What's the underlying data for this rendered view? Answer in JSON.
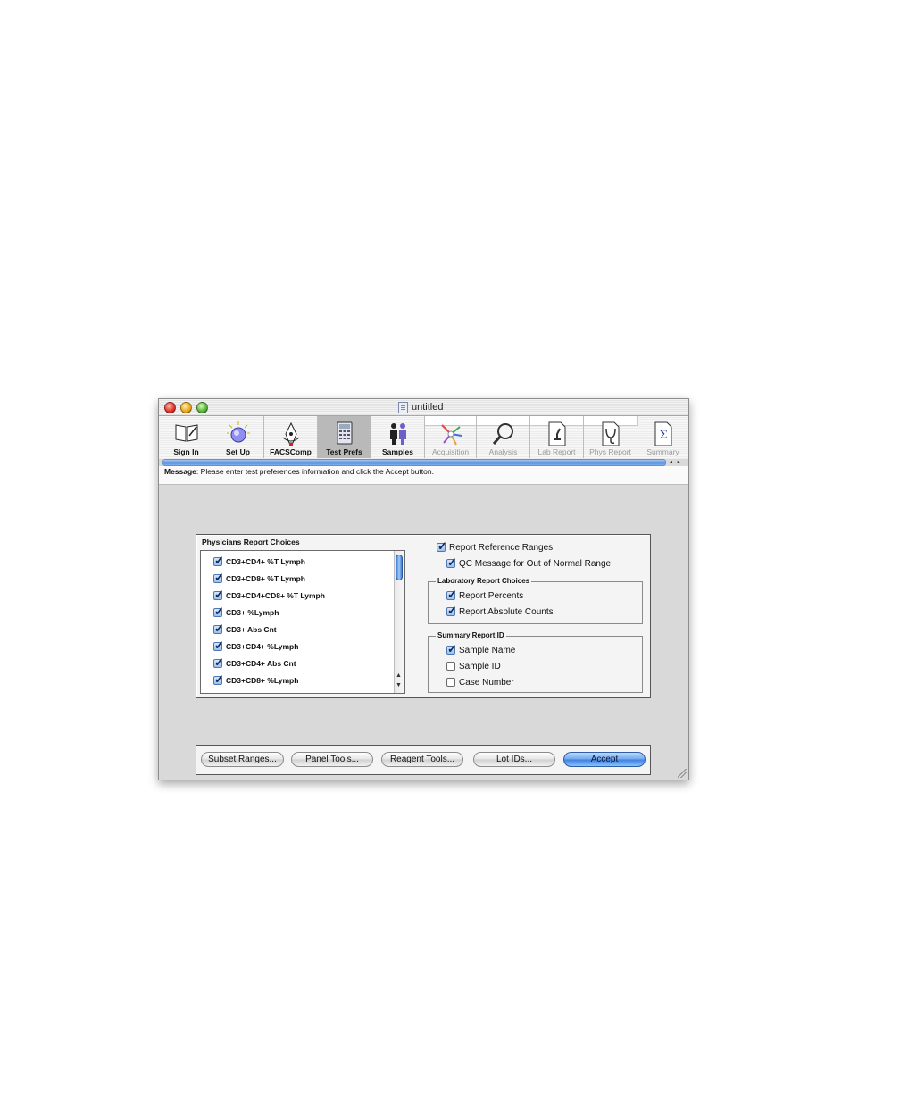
{
  "window": {
    "title": "untitled"
  },
  "toolbar": {
    "items": [
      {
        "label": "Sign In",
        "icon": "book-icon",
        "active": false,
        "enabled": true
      },
      {
        "label": "Set Up",
        "icon": "bead-icon",
        "active": false,
        "enabled": true
      },
      {
        "label": "FACSComp",
        "icon": "pen-icon",
        "active": false,
        "enabled": true
      },
      {
        "label": "Test Prefs",
        "icon": "calculator-icon",
        "active": true,
        "enabled": true
      },
      {
        "label": "Samples",
        "icon": "people-icon",
        "active": false,
        "enabled": true
      },
      {
        "label": "Acquisition",
        "icon": "acquisition-burst-icon",
        "active": false,
        "enabled": false
      },
      {
        "label": "Analysis",
        "icon": "magnifier-icon",
        "active": false,
        "enabled": false
      },
      {
        "label": "Lab Report",
        "icon": "microscope-report-icon",
        "active": false,
        "enabled": false
      },
      {
        "label": "Phys Report",
        "icon": "stethoscope-report-icon",
        "active": false,
        "enabled": false
      },
      {
        "label": "Summary",
        "icon": "sigma-icon",
        "active": false,
        "enabled": false
      }
    ]
  },
  "message": {
    "prefix": "Message",
    "text": ": Please enter test preferences information and click the Accept button."
  },
  "physicians_panel": {
    "title": "Physicians Report Choices",
    "items": [
      {
        "label": "CD3+CD4+ %T Lymph",
        "checked": true
      },
      {
        "label": "CD3+CD8+ %T Lymph",
        "checked": true
      },
      {
        "label": "CD3+CD4+CD8+ %T Lymph",
        "checked": true
      },
      {
        "label": "CD3+ %Lymph",
        "checked": true
      },
      {
        "label": "CD3+ Abs Cnt",
        "checked": true
      },
      {
        "label": "CD3+CD4+ %Lymph",
        "checked": true
      },
      {
        "label": "CD3+CD4+ Abs Cnt",
        "checked": true
      },
      {
        "label": "CD3+CD8+ %Lymph",
        "checked": true
      }
    ]
  },
  "options": {
    "report_reference_ranges": {
      "label": "Report Reference Ranges",
      "checked": true
    },
    "qc_message": {
      "label": "QC Message for Out of Normal Range",
      "checked": true
    }
  },
  "lab_group": {
    "title": "Laboratory Report Choices",
    "items": [
      {
        "label": "Report Percents",
        "checked": true
      },
      {
        "label": "Report Absolute Counts",
        "checked": true
      }
    ]
  },
  "summary_group": {
    "title": "Summary Report ID",
    "items": [
      {
        "label": "Sample Name",
        "checked": true
      },
      {
        "label": "Sample ID",
        "checked": false
      },
      {
        "label": "Case Number",
        "checked": false
      }
    ]
  },
  "buttons": {
    "subset_ranges": "Subset Ranges...",
    "panel_tools": "Panel Tools...",
    "reagent_tools": "Reagent Tools...",
    "lot_ids": "Lot IDs...",
    "accept": "Accept"
  },
  "colors": {
    "accent": "#4f8ee0",
    "active_tool": "#b9b9b9"
  }
}
